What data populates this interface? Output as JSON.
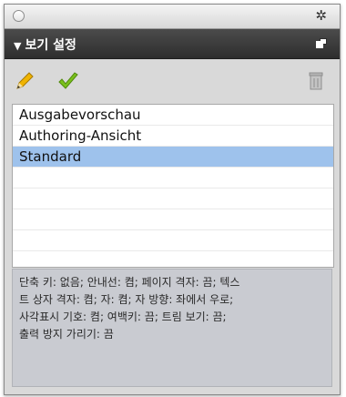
{
  "window": {
    "close_icon": "close-circle-icon",
    "settings_icon": "gear-icon"
  },
  "header": {
    "disclosure": "▼",
    "title": "보기 설정",
    "menu_icon": "panel-menu-icon"
  },
  "toolbar": {
    "edit_icon": "pencil-icon",
    "apply_icon": "checkmark-icon",
    "delete_icon": "trash-icon"
  },
  "views": [
    {
      "label": "Ausgabevorschau",
      "selected": false
    },
    {
      "label": "Authoring-Ansicht",
      "selected": false
    },
    {
      "label": "Standard",
      "selected": true
    }
  ],
  "info": {
    "lines": [
      "단축 키: 없음; 안내선: 켬;  페이지 격자: 끔;  텍스",
      "트 상자 격자: 켬;  자: 켬;  자 방향:  좌에서 우로;",
      "사각표시 기호: 켬;  여백키: 끔;  트림 보기: 끔;",
      "출력 방지 가리기: 끔"
    ]
  },
  "colors": {
    "header_bg": "#3a3a3a",
    "selection": "#9ec2ec",
    "pencil": "#f0b400",
    "check": "#7ac01c",
    "info_bg": "#c9cbd1"
  }
}
